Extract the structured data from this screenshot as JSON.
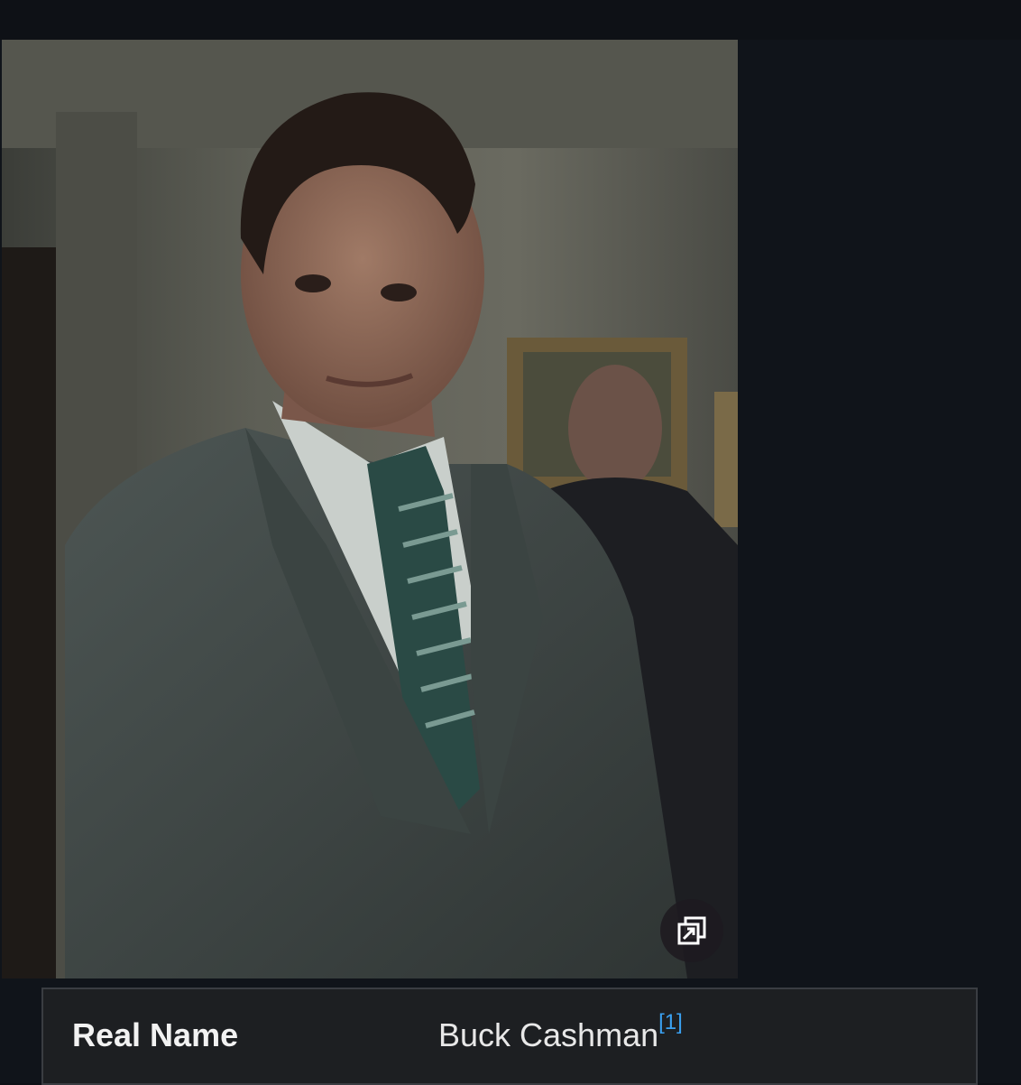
{
  "infobox": {
    "image": {
      "description_icon": "character-portrait",
      "expand_icon": "expand-icon"
    },
    "rows": [
      {
        "label": "Real Name",
        "value": "Buck Cashman",
        "citation": "[1]"
      }
    ]
  },
  "colors": {
    "page_background": "#0e1116",
    "row_background": "#1d1f22",
    "row_border": "#3a3d42",
    "citation_link": "#3aa0f0"
  }
}
